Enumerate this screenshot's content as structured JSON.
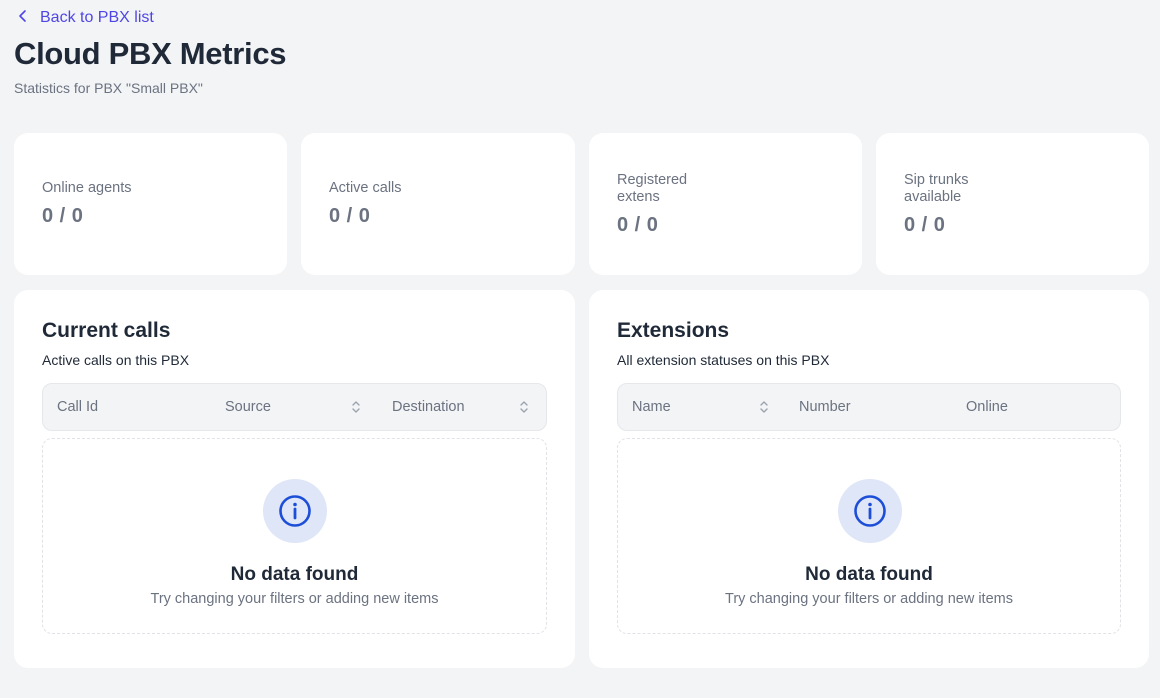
{
  "header": {
    "back_label": "Back to PBX list",
    "title": "Cloud PBX Metrics",
    "subtitle": "Statistics for PBX \"Small PBX\""
  },
  "stats": [
    {
      "label": "Online agents",
      "value": "0 / 0"
    },
    {
      "label": "Active calls",
      "value": "0 / 0"
    },
    {
      "label": "Registered extens",
      "value": "0 / 0"
    },
    {
      "label": "Sip trunks available",
      "value": "0 / 0"
    }
  ],
  "current_calls": {
    "title": "Current calls",
    "subtitle": "Active calls on this PBX",
    "columns": [
      "Call Id",
      "Source",
      "Destination"
    ],
    "empty_title": "No data found",
    "empty_text": "Try changing your filters or adding new items"
  },
  "extensions": {
    "title": "Extensions",
    "subtitle": "All extension statuses on this PBX",
    "columns": [
      "Name",
      "Number",
      "Online"
    ],
    "empty_title": "No data found",
    "empty_text": "Try changing your filters or adding new items"
  },
  "icons": {
    "back": "chevron-left-icon",
    "sort": "sort-updown-icon",
    "empty": "info-icon"
  },
  "colors": {
    "accent": "#4f46e5",
    "info_icon": "#1d4ed8",
    "info_bg": "#dfe6f7"
  }
}
